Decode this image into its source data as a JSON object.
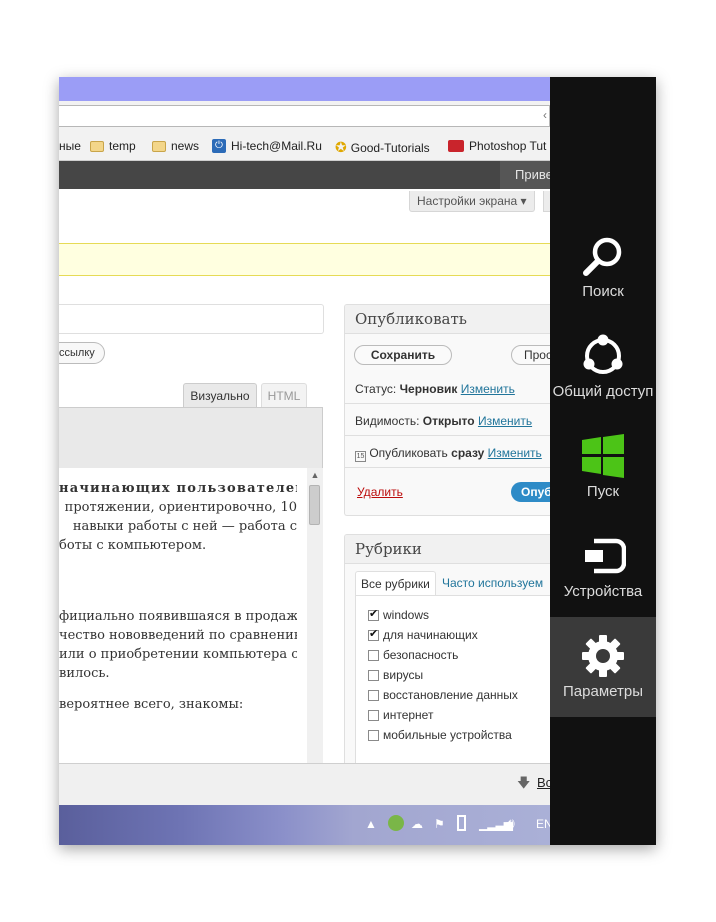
{
  "bookmarks": [
    {
      "label": "ные",
      "icon": "folder-icon"
    },
    {
      "label": "temp",
      "icon": "folder-icon"
    },
    {
      "label": "news",
      "icon": "folder-icon"
    },
    {
      "label": "Hi-tech@Mail.Ru",
      "icon": "mailru-icon"
    },
    {
      "label": "Good-Tutorials",
      "icon": "star-icon"
    },
    {
      "label": "Photoshop Tut",
      "icon": "photoshop-icon"
    }
  ],
  "admin_bar": {
    "greeting": "Приве"
  },
  "screen_options": "Настройки экрана ▾",
  "permalink": {
    "button": "ссылку"
  },
  "editor": {
    "tab_visual": "Визуально",
    "tab_html": "HTML",
    "lines": [
      "начинающих пользователей,",
      "протяжении, ориентировочно, 10",
      "навыки работы с ней — работа с",
      "боты с компьютером.",
      "фициально появившаяся в продаже",
      "чество нововведений по сравнению",
      "или о приобретении компьютера с",
      "вилось.",
      "вероятнее всего, знакомы:"
    ]
  },
  "publish": {
    "title": "Опубликовать",
    "save_draft": "Сохранить",
    "preview": "Просм",
    "status_label": "Статус:",
    "status_value": "Черновик",
    "visibility_label": "Видимость:",
    "visibility_value": "Открыто",
    "publish_label": "Опубликовать",
    "publish_value": "сразу",
    "edit_link": "Изменить",
    "delete": "Удалить",
    "publish_button": "Опубл"
  },
  "categories": {
    "title": "Рубрики",
    "tab_all": "Все рубрики",
    "tab_popular": "Часто используем",
    "items": [
      {
        "label": "windows",
        "checked": true
      },
      {
        "label": "для начинающих",
        "checked": true
      },
      {
        "label": "безопасность",
        "checked": false
      },
      {
        "label": "вирусы",
        "checked": false
      },
      {
        "label": "восстановление данных",
        "checked": false
      },
      {
        "label": "интернет",
        "checked": false
      },
      {
        "label": "мобильные устройства",
        "checked": false
      }
    ]
  },
  "download_bar": {
    "label": "Вс"
  },
  "taskbar": {
    "language": "EN"
  },
  "charms": [
    {
      "label": "Поиск",
      "icon": "search-icon"
    },
    {
      "label": "Общий доступ",
      "icon": "share-icon"
    },
    {
      "label": "Пуск",
      "icon": "windows-start-icon"
    },
    {
      "label": "Устройства",
      "icon": "devices-icon"
    },
    {
      "label": "Параметры",
      "icon": "settings-gear-icon"
    }
  ],
  "colors": {
    "charms_bg": "#111111",
    "windows_logo": "#4cc417",
    "publish_button": "#2e8bc7",
    "notice_bg": "#ffffe0"
  }
}
